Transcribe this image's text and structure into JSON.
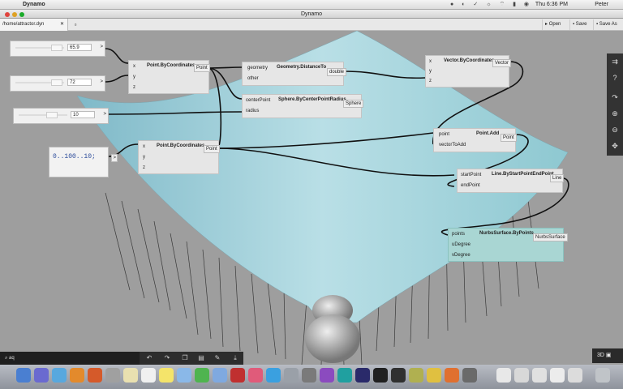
{
  "menubar": {
    "app_name": "Dynamo",
    "clock": "Thu 6:36 PM",
    "user": "Peter",
    "status_icons": "● ◐ ✓ ☼ ⌔ ▮ ◉"
  },
  "window": {
    "title": "Dynamo"
  },
  "tabs": [
    {
      "label": "/home/attractor.dyn",
      "close": "✕"
    }
  ],
  "toolbar": {
    "open": "Open",
    "save": "Save",
    "save_as": "Save As"
  },
  "sliders": [
    {
      "value": "65.9"
    },
    {
      "value": "72"
    },
    {
      "value": "10"
    }
  ],
  "code_block": {
    "code": "0..100..10;"
  },
  "nodes": {
    "point_coords_1": {
      "title": "Point.ByCoordinates",
      "inputs": [
        "x",
        "y",
        "z"
      ],
      "output": "Point"
    },
    "point_coords_2": {
      "title": "Point.ByCoordinates",
      "inputs": [
        "x",
        "y",
        "z"
      ],
      "output": "Point"
    },
    "distance_to": {
      "title": "Geometry.DistanceTo",
      "inputs": [
        "geometry",
        "other"
      ],
      "output": "double"
    },
    "sphere": {
      "title": "Sphere.ByCenterPointRadius",
      "inputs": [
        "centerPoint",
        "radius"
      ],
      "output": "Sphere"
    },
    "vector": {
      "title": "Vector.ByCoordinates",
      "inputs": [
        "x",
        "y",
        "z"
      ],
      "output": "Vector"
    },
    "point_add": {
      "title": "Point.Add",
      "inputs": [
        "point",
        "vectorToAdd"
      ],
      "output": "Point"
    },
    "line": {
      "title": "Line.ByStartPointEndPoint",
      "inputs": [
        "startPoint",
        "endPoint"
      ],
      "output": "Line"
    },
    "nurbs": {
      "title": "NurbsSurface.ByPoints",
      "inputs": [
        "points",
        "uDegree",
        "vDegree"
      ],
      "output": "NurbsSurface"
    }
  },
  "right_panel": {
    "icons": [
      "⇉",
      "?",
      "↷",
      "⊕",
      "⊖",
      "✥"
    ]
  },
  "bottom": {
    "search": "⌕ aq",
    "undo": "↶",
    "redo": "↷",
    "copy": "❐",
    "paste": "▤",
    "clean": "✎",
    "export": "⤓"
  },
  "view_toggle": {
    "label": "3D"
  }
}
